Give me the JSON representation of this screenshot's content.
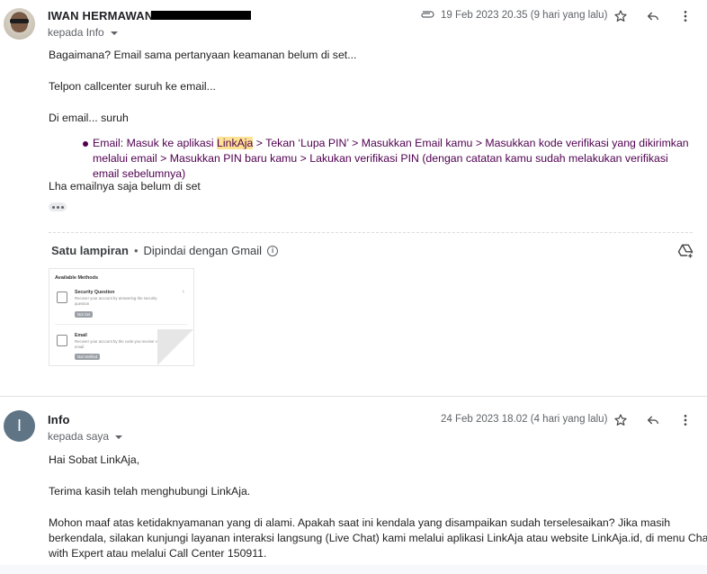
{
  "message1": {
    "sender": "IWAN HERMAWAN",
    "recipient": "kepada Info",
    "date": "19 Feb 2023 20.35 (9 hari yang lalu)",
    "body": {
      "p1": "Bagaimana? Email sama pertanyaan keamanan belum di set...",
      "p2": "Telpon callcenter suruh ke email...",
      "p3": "Di email... suruh",
      "li_prefix": "Email: Masuk ke aplikasi ",
      "li_highlight": "LinkAja",
      "li_suffix": " > Tekan ‘Lupa PIN’ > Masukkan Email kamu > Masukkan kode verifikasi yang dikirimkan melalui email > Masukkan PIN baru kamu > Lakukan verifikasi PIN (dengan catatan kamu sudah melakukan verifikasi email sebelumnya)",
      "p4": "Lha emailnya saja belum di set"
    },
    "attachment": {
      "title": "Satu lampiran",
      "dot": "•",
      "scanned": "Dipindai dengan Gmail",
      "thumbnail": {
        "heading": "Available Methods",
        "items": [
          {
            "title": "Security Question",
            "desc": "Recover your account by answering the security question",
            "badge": "Not Set"
          },
          {
            "title": "Email",
            "desc": "Recover your account by the code you receive via email",
            "badge": "Not Verified"
          }
        ]
      }
    }
  },
  "message2": {
    "sender": "Info",
    "avatar_letter": "I",
    "recipient": "kepada saya",
    "date": "24 Feb 2023 18.02 (4 hari yang lalu)",
    "body": {
      "p1": "Hai Sobat LinkAja,",
      "p2": "Terima kasih telah menghubungi LinkAja.",
      "p3_line1": "Mohon maaf atas ketidaknyamanan yang di alami. Apakah saat ini kendala yang disampaikan sudah terselesaikan? Jika masih",
      "p3_line2": "berkendala, silakan kunjungi layanan interaksi langsung (Live Chat) kami melalui aplikasi LinkAja atau website LinkAja.id, di menu Chat",
      "p3_line3": "with Expert atau melalui Call Center 150911."
    }
  },
  "icons": {
    "star": "star-icon",
    "reply": "reply-icon",
    "more": "more-vert-icon",
    "attachment": "paperclip-icon",
    "drive": "add-to-drive-icon",
    "info": "info-icon"
  },
  "colors": {
    "link_purple": "#500050",
    "highlight": "#fde293",
    "avatar_bg": "#5f7585"
  }
}
